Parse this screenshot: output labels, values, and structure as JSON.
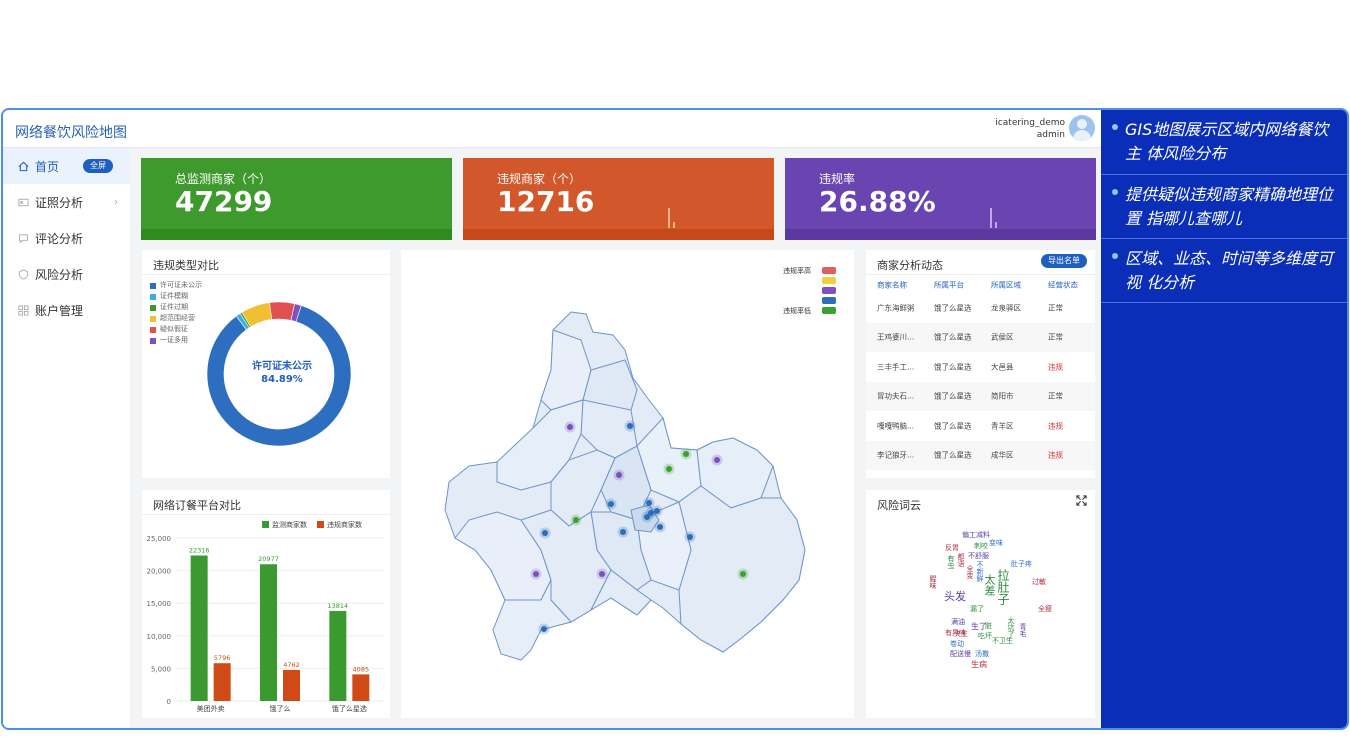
{
  "app": {
    "title": "网络餐饮风险地图"
  },
  "user": {
    "username": "icatering_demo",
    "role": "admin"
  },
  "sidebar": {
    "full_label": "全屏",
    "items": [
      {
        "label": "首页",
        "icon": "home-icon",
        "active": true
      },
      {
        "label": "证照分析",
        "icon": "id-card-icon",
        "expandable": true
      },
      {
        "label": "评论分析",
        "icon": "comment-icon"
      },
      {
        "label": "风险分析",
        "icon": "shield-icon"
      },
      {
        "label": "账户管理",
        "icon": "grid-icon"
      }
    ]
  },
  "kpis": [
    {
      "label": "总监测商家（个）",
      "value": "47299",
      "color": "#3f9a2e",
      "strip": "#2f8a20"
    },
    {
      "label": "违规商家（个）",
      "value": "12716",
      "color": "#d2572a",
      "strip": "#c84a1c"
    },
    {
      "label": "违规率",
      "value": "26.88%",
      "color": "#6a44b0",
      "strip": "#5a38a0"
    }
  ],
  "violation_types": {
    "title": "违规类型对比",
    "center_label": "许可证未公示",
    "center_value": "84.89%"
  },
  "platforms": {
    "title": "网络订餐平台对比"
  },
  "map": {
    "legend_high": "违规率高",
    "legend_low": "违规率低",
    "legend_colors": [
      "#e06060",
      "#f0d040",
      "#8050c0",
      "#2e6db8",
      "#3aa030"
    ]
  },
  "merchants": {
    "title": "商家分析动态",
    "export_label": "导出名单",
    "headers": [
      "商家名称",
      "所属平台",
      "所属区域",
      "经营状态"
    ],
    "rows": [
      {
        "name": "广东海鲜粥",
        "platform": "饿了么星选",
        "region": "龙泉驿区",
        "status": "正常",
        "violation": false
      },
      {
        "name": "王鸡婆川...",
        "platform": "饿了么星选",
        "region": "武侯区",
        "status": "正常",
        "violation": false
      },
      {
        "name": "三丰手工...",
        "platform": "饿了么星选",
        "region": "大邑县",
        "status": "违规",
        "violation": true
      },
      {
        "name": "冒功夫石...",
        "platform": "饿了么星选",
        "region": "简阳市",
        "status": "正常",
        "violation": false
      },
      {
        "name": "嘎嘎鸭脑...",
        "platform": "饿了么星选",
        "region": "青羊区",
        "status": "违规",
        "violation": true
      },
      {
        "name": "李记狼牙...",
        "platform": "饿了么星选",
        "region": "成华区",
        "status": "违规",
        "violation": true
      }
    ]
  },
  "wordcloud": {
    "title": "风险词云",
    "words": [
      {
        "t": "偏工减料",
        "c": "#5a3fa8"
      },
      {
        "t": "刺咬",
        "c": "#2b8a3e"
      },
      {
        "t": "变味",
        "c": "#2b6fd0"
      },
      {
        "t": "反胃",
        "c": "#b03040"
      },
      {
        "t": "不舒服",
        "c": "#5a3fa8"
      },
      {
        "t": "有虫",
        "c": "#2b8a3e"
      },
      {
        "t": "都语",
        "c": "#b03040"
      },
      {
        "t": "肚子疼",
        "c": "#2b6fd0"
      },
      {
        "t": "头发",
        "c": "#5a3fa8"
      },
      {
        "t": "不新鲜",
        "c": "#2b6fd0"
      },
      {
        "t": "太差",
        "c": "#2b8a3e"
      },
      {
        "t": "拉肚子",
        "c": "#2b8a3e"
      },
      {
        "t": "腥味",
        "c": "#b03040"
      },
      {
        "t": "全变",
        "c": "#b03040"
      },
      {
        "t": "过敏",
        "c": "#b03040"
      },
      {
        "t": "漏了",
        "c": "#2b8a3e"
      },
      {
        "t": "满油",
        "c": "#5a3fa8"
      },
      {
        "t": "生了",
        "c": "#5a3fa8"
      },
      {
        "t": "夹生",
        "c": "#b03040"
      },
      {
        "t": "不卫生",
        "c": "#2b8a3e"
      },
      {
        "t": "有异味",
        "c": "#b03040"
      },
      {
        "t": "吃坏",
        "c": "#2b8a3e"
      },
      {
        "t": "卷动",
        "c": "#2b6fd0"
      },
      {
        "t": "配送慢",
        "c": "#5a3fa8"
      },
      {
        "t": "汤撒",
        "c": "#2b6fd0"
      },
      {
        "t": "生病",
        "c": "#b03040"
      },
      {
        "t": "青毛",
        "c": "#5a3fa8"
      },
      {
        "t": "全瘦",
        "c": "#b03040"
      },
      {
        "t": "太坑了",
        "c": "#2b8a3e"
      },
      {
        "t": "脏",
        "c": "#2b8a3e"
      }
    ]
  },
  "blue_panel": {
    "items": [
      "GIS地图展示区域内网络餐饮主 体风险分布",
      "提供疑似违规商家精确地理位置 指哪儿查哪儿",
      "区域、业态、时间等多维度可视 化分析"
    ]
  },
  "chart_data": [
    {
      "type": "pie",
      "title": "违规类型对比",
      "categories": [
        "许可证未公示",
        "证件模糊",
        "证件过期",
        "超范围经营",
        "疑似假证",
        "一证多用"
      ],
      "values": [
        84.89,
        1.0,
        0.5,
        6.5,
        5.6,
        1.5
      ],
      "colors": [
        "#2e6ec0",
        "#3ab0e0",
        "#3a9a30",
        "#f0c030",
        "#e05050",
        "#8050c0"
      ],
      "legend": "left"
    },
    {
      "type": "bar",
      "title": "网络订餐平台对比",
      "categories": [
        "美团外卖",
        "饿了么",
        "饿了么星选"
      ],
      "series": [
        {
          "name": "监测商家数",
          "values": [
            22316,
            20977,
            13814
          ],
          "color": "#3a9a30"
        },
        {
          "name": "违规商家数",
          "values": [
            5796,
            4762,
            4085
          ],
          "color": "#d04a18"
        }
      ],
      "ylim": [
        0,
        25000
      ],
      "yticks": [
        "0",
        "5,000",
        "10,000",
        "15,000",
        "20,000",
        "25,000"
      ],
      "grid": true,
      "legend": "top-right"
    }
  ]
}
